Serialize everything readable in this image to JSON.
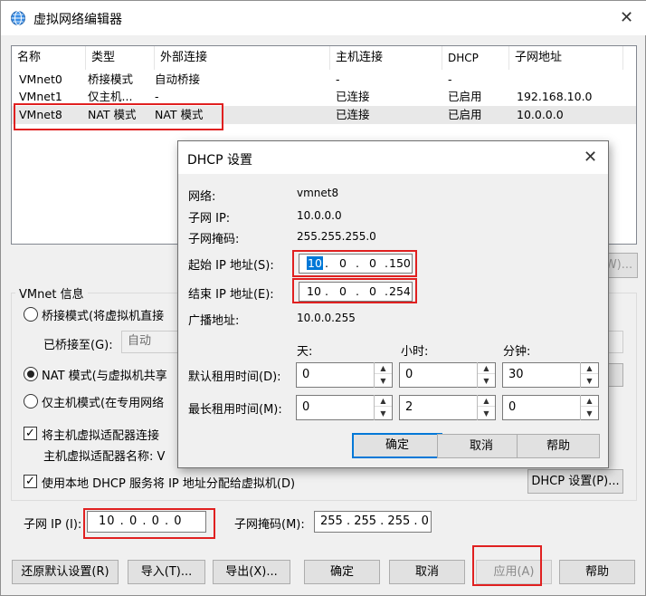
{
  "window": {
    "title": "虚拟网络编辑器",
    "close_glyph": "✕"
  },
  "network_list": {
    "columns": [
      "名称",
      "类型",
      "外部连接",
      "主机连接",
      "DHCP",
      "子网地址"
    ],
    "rows": [
      {
        "name": "VMnet0",
        "type": "桥接模式",
        "external": "自动桥接",
        "host": "-",
        "dhcp": "-",
        "subnet": ""
      },
      {
        "name": "VMnet1",
        "type": "仅主机...",
        "external": "-",
        "host": "已连接",
        "dhcp": "已启用",
        "subnet": "192.168.10.0"
      },
      {
        "name": "VMnet8",
        "type": "NAT 模式",
        "external": "NAT 模式",
        "host": "已连接",
        "dhcp": "已启用",
        "subnet": "10.0.0.0"
      }
    ]
  },
  "partial_button_text": "W)...",
  "vmnet_info": {
    "label": "VMnet 信息",
    "bridged_radio": "桥接模式(将虚拟机直接",
    "bridged_to_label": "已桥接至(G):",
    "bridged_to_value": "自动",
    "nat_radio": "NAT 模式(与虚拟机共享",
    "hostonly_radio": "仅主机模式(在专用网络",
    "connect_adapter_check": "将主机虚拟适配器连接",
    "adapter_name_label": "主机虚拟适配器名称: V",
    "dhcp_check": "使用本地 DHCP 服务将 IP 地址分配给虚拟机(D)",
    "dhcp_settings_button": "DHCP 设置(P)...",
    "subnet_ip_label": "子网 IP (I):",
    "subnet_ip_value": "10 . 0 . 0 . 0",
    "subnet_mask_label": "子网掩码(M):",
    "subnet_mask_value": "255 . 255 . 255 . 0"
  },
  "bottom_buttons": {
    "restore": "还原默认设置(R)",
    "import": "导入(T)...",
    "export": "导出(X)...",
    "ok": "确定",
    "cancel": "取消",
    "apply": "应用(A)",
    "help": "帮助"
  },
  "dhcp_dialog": {
    "title": "DHCP 设置",
    "network_label": "网络:",
    "network_value": "vmnet8",
    "subnet_ip_label": "子网 IP:",
    "subnet_ip_value": "10.0.0.0",
    "subnet_mask_label": "子网掩码:",
    "subnet_mask_value": "255.255.255.0",
    "start_ip_label": "起始 IP 地址(S):",
    "start_ip_octets": [
      "10",
      "0",
      "0",
      "150"
    ],
    "end_ip_label": "结束 IP 地址(E):",
    "end_ip_octets": [
      "10",
      "0",
      "0",
      "254"
    ],
    "broadcast_label": "广播地址:",
    "broadcast_value": "10.0.0.255",
    "col_days": "天:",
    "col_hours": "小时:",
    "col_minutes": "分钟:",
    "default_lease_label": "默认租用时间(D):",
    "default_lease": {
      "days": "0",
      "hours": "0",
      "minutes": "30"
    },
    "max_lease_label": "最长租用时间(M):",
    "max_lease": {
      "days": "0",
      "hours": "2",
      "minutes": "0"
    },
    "ok": "确定",
    "cancel": "取消",
    "help": "帮助"
  },
  "colors": {
    "highlight_red": "#e02020",
    "selection_blue": "#0078d7"
  }
}
